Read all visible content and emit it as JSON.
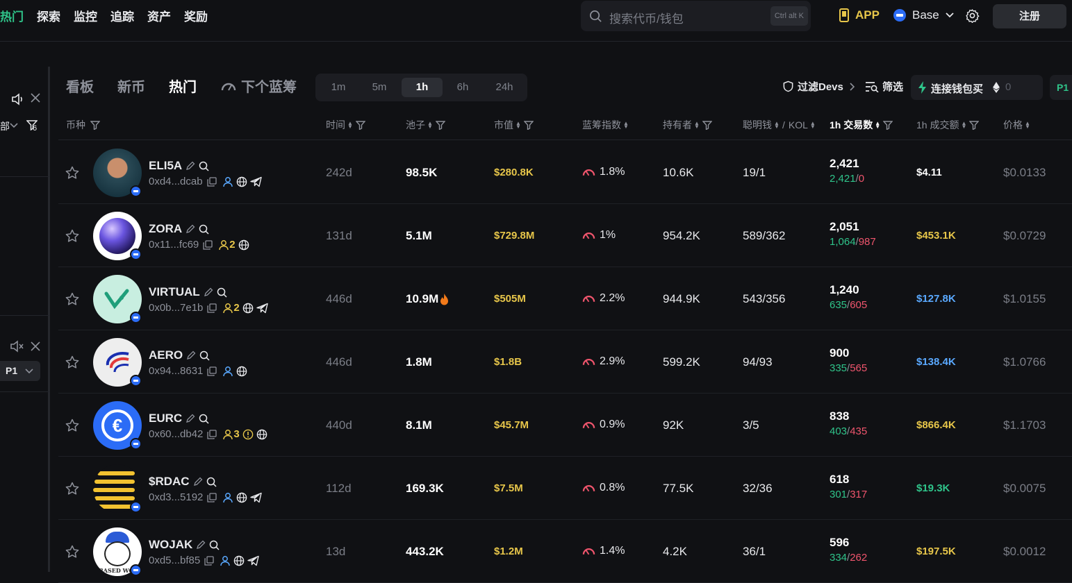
{
  "nav": {
    "items": [
      "热门",
      "探索",
      "监控",
      "追踪",
      "资产",
      "奖励"
    ]
  },
  "search": {
    "placeholder": "搜索代币/钱包",
    "shortcut": "Ctrl alt K"
  },
  "header": {
    "app": "APP",
    "chain": "Base",
    "register": "注册"
  },
  "leftpanel": {
    "label_cut": "部",
    "filter_count": "6",
    "page": "P1"
  },
  "tabs": [
    "看板",
    "新币",
    "热门",
    "下个蓝筹"
  ],
  "timeframes": [
    "1m",
    "5m",
    "1h",
    "6h",
    "24h"
  ],
  "timeframe_selected": "1h",
  "controls": {
    "filter_devs": "过滤Devs",
    "screen": "筛选",
    "connect": "连接钱包买",
    "eth_amount": "0",
    "preset": "P1"
  },
  "columns": {
    "coin": "币种",
    "time": "时间",
    "pool": "池子",
    "mcap": "市值",
    "bluechip": "蓝筹指数",
    "holders": "持有者",
    "smart": "聪明钱",
    "kol": "KOL",
    "tx": "1h 交易数",
    "volume": "1h 成交额",
    "price": "价格"
  },
  "colors": {
    "accent_green": "#2fc48a",
    "sell_red": "#f0556d",
    "gold": "#e7c64a",
    "blue": "#5aa9ff"
  },
  "rows": [
    {
      "name": "ELI5A",
      "addr": "0xd4...dcab",
      "holders_count": "",
      "icons": [
        "user-icon",
        "globe-icon",
        "telegram-icon"
      ],
      "time": "242d",
      "pool": "98.5K",
      "hot": false,
      "mcap": "$280.8K",
      "bluechip": "1.8%",
      "holders": "10.6K",
      "smart": "19/1",
      "tx": "2,421",
      "buys": "2,421",
      "sells": "0",
      "volume": "$4.11",
      "vol_color": "#ffffff",
      "price": "$0.0133",
      "avatar": "portrait"
    },
    {
      "name": "ZORA",
      "addr": "0x11...fc69",
      "holders_count": "2",
      "icons": [
        "globe-icon"
      ],
      "time": "131d",
      "pool": "5.1M",
      "hot": false,
      "mcap": "$729.8M",
      "bluechip": "1%",
      "holders": "954.2K",
      "smart": "589/362",
      "tx": "2,051",
      "buys": "1,064",
      "sells": "987",
      "volume": "$453.1K",
      "vol_color": "#e7c64a",
      "price": "$0.0729",
      "avatar": "orb"
    },
    {
      "name": "VIRTUAL",
      "addr": "0x0b...7e1b",
      "holders_count": "2",
      "icons": [
        "globe-icon",
        "telegram-icon"
      ],
      "time": "446d",
      "pool": "10.9M",
      "hot": true,
      "mcap": "$505M",
      "bluechip": "2.2%",
      "holders": "944.9K",
      "smart": "543/356",
      "tx": "1,240",
      "buys": "635",
      "sells": "605",
      "volume": "$127.8K",
      "vol_color": "#5aa9ff",
      "price": "$1.0155",
      "avatar": "virtual"
    },
    {
      "name": "AERO",
      "addr": "0x94...8631",
      "holders_count": "",
      "icons": [
        "user-icon",
        "globe-icon"
      ],
      "time": "446d",
      "pool": "1.8M",
      "hot": false,
      "mcap": "$1.8B",
      "bluechip": "2.9%",
      "holders": "599.2K",
      "smart": "94/93",
      "tx": "900",
      "buys": "335",
      "sells": "565",
      "volume": "$138.4K",
      "vol_color": "#5aa9ff",
      "price": "$1.0766",
      "avatar": "aero"
    },
    {
      "name": "EURC",
      "addr": "0x60...db42",
      "holders_count": "3",
      "icons": [
        "warn-icon",
        "globe-icon"
      ],
      "time": "440d",
      "pool": "8.1M",
      "hot": false,
      "mcap": "$45.7M",
      "bluechip": "0.9%",
      "holders": "92K",
      "smart": "3/5",
      "tx": "838",
      "buys": "403",
      "sells": "435",
      "volume": "$866.4K",
      "vol_color": "#e7c64a",
      "price": "$1.1703",
      "avatar": "eurc"
    },
    {
      "name": "$RDAC",
      "addr": "0xd3...5192",
      "holders_count": "",
      "icons": [
        "user-icon",
        "globe-icon",
        "telegram-icon"
      ],
      "time": "112d",
      "pool": "169.3K",
      "hot": false,
      "mcap": "$7.5M",
      "bluechip": "0.8%",
      "holders": "77.5K",
      "smart": "32/36",
      "tx": "618",
      "buys": "301",
      "sells": "317",
      "volume": "$19.3K",
      "vol_color": "#2fc48a",
      "price": "$0.0075",
      "avatar": "rdac"
    },
    {
      "name": "WOJAK",
      "addr": "0xd5...bf85",
      "holders_count": "",
      "icons": [
        "user-icon",
        "globe-icon",
        "telegram-icon"
      ],
      "time": "13d",
      "pool": "443.2K",
      "hot": false,
      "mcap": "$1.2M",
      "bluechip": "1.4%",
      "holders": "4.2K",
      "smart": "36/1",
      "tx": "596",
      "buys": "334",
      "sells": "262",
      "volume": "$197.5K",
      "vol_color": "#e7c64a",
      "price": "$0.0012",
      "avatar": "wojak",
      "avatar_text": "BASED WOJAK"
    }
  ]
}
